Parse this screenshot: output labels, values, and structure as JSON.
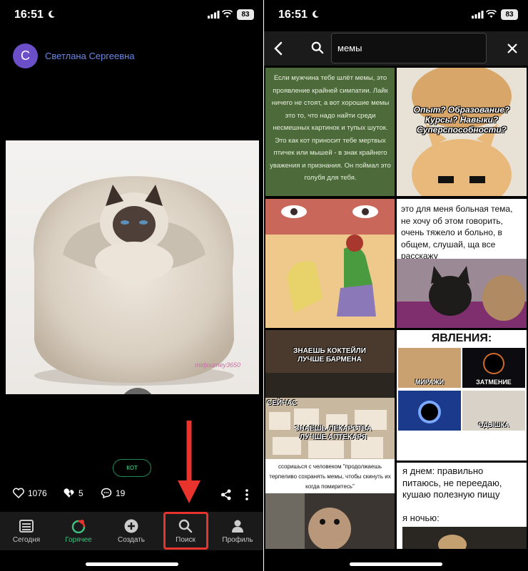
{
  "status_left": {
    "time": "16:51",
    "battery": "83"
  },
  "status_right": {
    "time": "16:51",
    "battery": "83"
  },
  "post": {
    "avatar_letter": "С",
    "author": "Светлана Сергеевна",
    "watermark": "midjourney3650",
    "tag": "кот",
    "likes": "1076",
    "broken_hearts": "5",
    "comments": "19"
  },
  "tabbar": {
    "items": [
      {
        "label": "Сегодня",
        "icon": "list-icon"
      },
      {
        "label": "Горячее",
        "icon": "fire-icon"
      },
      {
        "label": "Создать",
        "icon": "plus-circle-icon"
      },
      {
        "label": "Поиск",
        "icon": "search-icon"
      },
      {
        "label": "Профиль",
        "icon": "person-icon"
      }
    ]
  },
  "search": {
    "query": "мемы"
  },
  "results": {
    "tile1": "Если мужчина тебе шлёт мемы, это проявление крайней симпатии. Лайк ничего не стоят, а вот хорошие мемы это то, что надо найти среди несмешных картинок и тупых шуток. Это как кот приносит тебе мертвых птичек или мышей - в знак крайнего уважения и признания. Он поймал это голубя для тебя.",
    "tile2": "Опыт? Образование? Курсы? Навыки? Суперспособности?",
    "tile4": "это для меня больная тема, не хочу об этом говорить, очень тяжело и больно, в общем, слушай, ща все расскажу",
    "tile5_top": "ЗНАЕШЬ КОКТЕЙЛИ ЛУЧШЕ БАРМЕНА",
    "tile5_mid": "СЕЙЧАС",
    "tile5_bottom": "ЗНАЕШЬ ЛЕКАРСТВА ЛУЧШЕ АПТЕКАРЯ",
    "tile6_head": "ЯВЛЕНИЯ:",
    "tile6_labels": [
      "МИРАЖИ",
      "ЗАТМЕНИЕ",
      "",
      "ОДЫШКА"
    ],
    "tile7": "ссоришься с человеком \"продолжаешь терпеливо сохранять мемы, чтобы скинуть их когда помиритесь\"",
    "tile8_top": "я днем: правильно питаюсь, не переедаю, кушаю полезную пищу",
    "tile8_bottom": "я ночью:"
  },
  "colors": {
    "accent_green": "#3fbf7f",
    "highlight_red": "#e9332d",
    "author_blue": "#6b88e6",
    "avatar_purple": "#6a4fc9"
  }
}
